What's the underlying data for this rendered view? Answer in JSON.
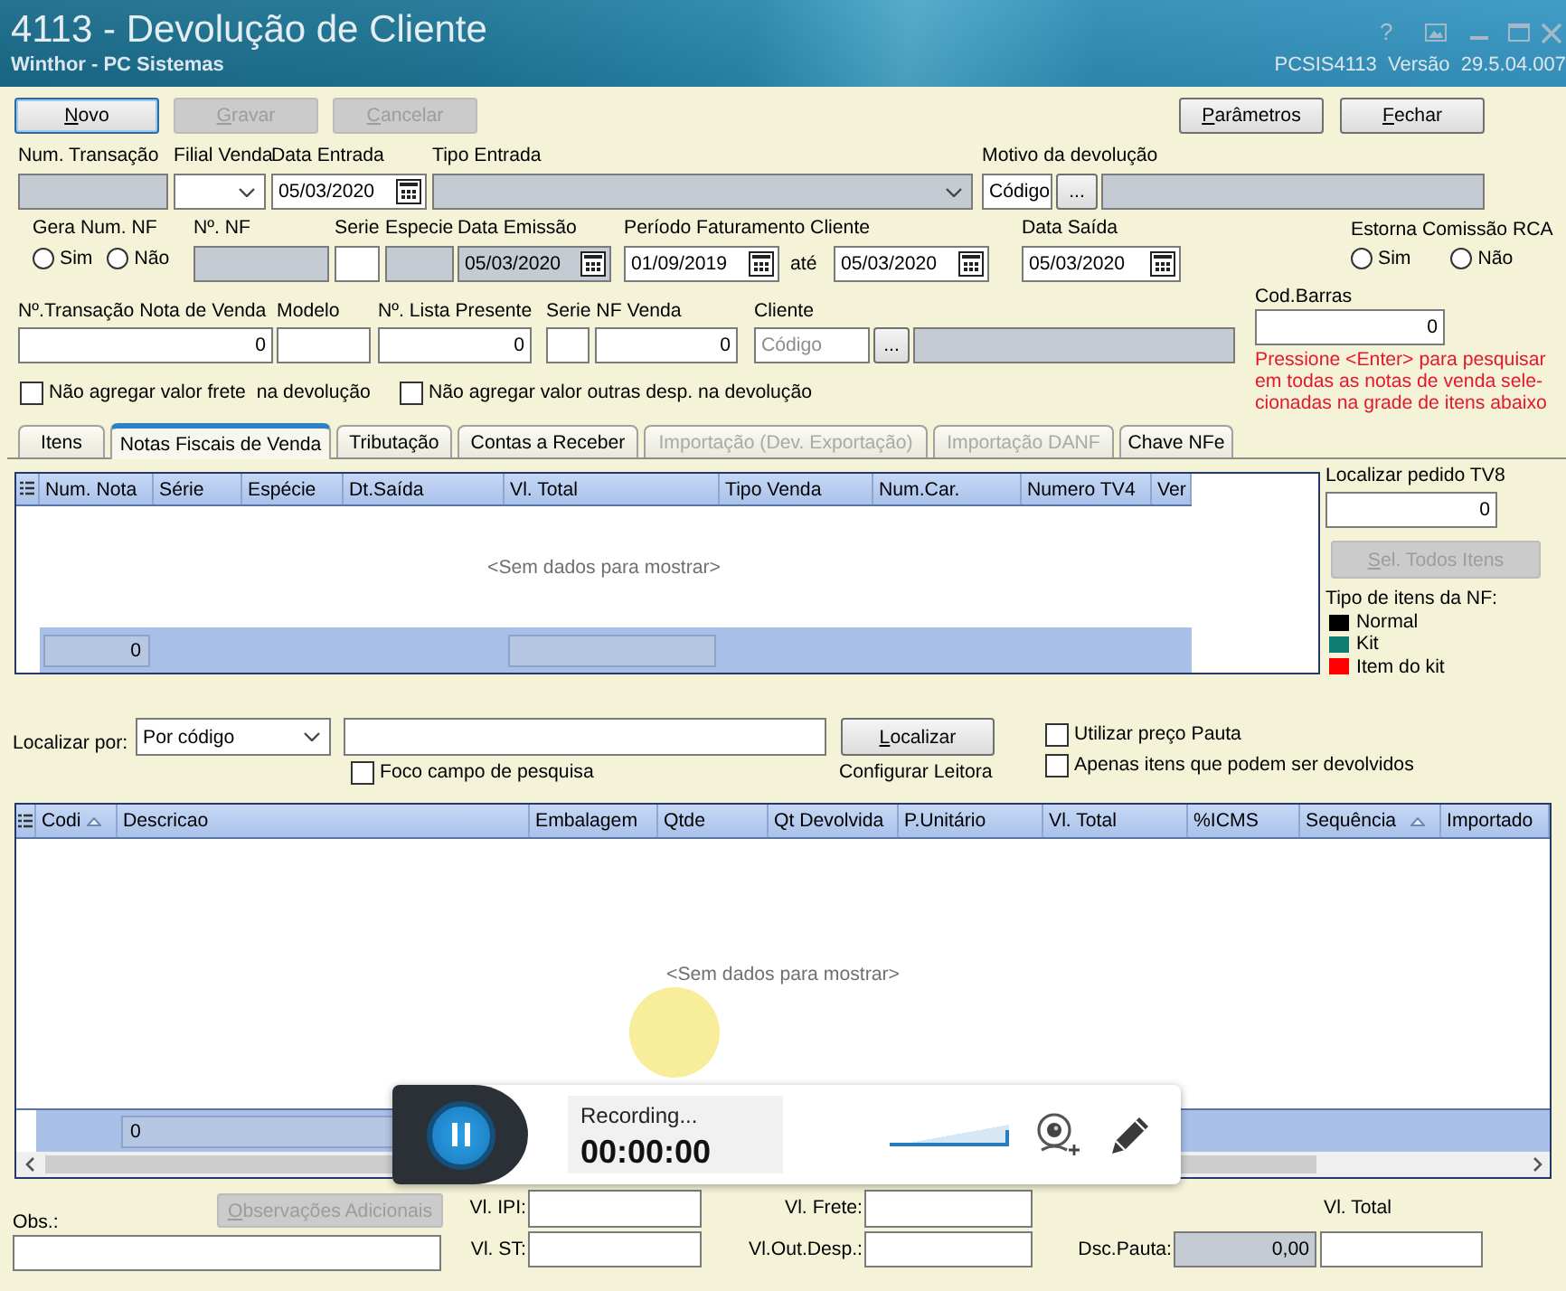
{
  "window": {
    "title": "4113 - Devolução de Cliente",
    "subtitle": "Winthor - PC Sistemas",
    "help": "?",
    "version": "PCSIS4113  Versão  29.5.04.007"
  },
  "toolbar": {
    "left": [
      {
        "label": "Novo",
        "disabled": false,
        "focused": true
      },
      {
        "label": "Gravar",
        "disabled": true,
        "focused": false
      },
      {
        "label": "Cancelar",
        "disabled": true,
        "focused": false
      }
    ],
    "right": [
      {
        "label": "Parâmetros",
        "disabled": false,
        "focused": false
      },
      {
        "label": "Fechar",
        "disabled": false,
        "focused": false
      }
    ]
  },
  "row_1": [
    {
      "kind": "text",
      "label": "Num. Transação",
      "readonly": true
    },
    {
      "kind": "combo",
      "label": "Filial Venda",
      "readonly": false
    },
    {
      "kind": "date",
      "label": "Data Entrada",
      "value": "05/03/2020",
      "readonly": false
    },
    {
      "kind": "combo",
      "label": "Tipo Entrada",
      "readonly": true
    },
    {
      "kind": "lookup",
      "label": "Motivo da devolução",
      "value": "Código",
      "button": "...",
      "readonly": true
    }
  ],
  "gera_num_nf": {
    "label": "Gera Num. NF",
    "options": [
      {
        "label": "Sim",
        "selected": false
      },
      {
        "label": "Não",
        "selected": false
      }
    ]
  },
  "row_2": [
    {
      "kind": "text",
      "label": "Nº. NF",
      "readonly": true
    },
    {
      "kind": "text",
      "label": "Serie",
      "readonly": false
    },
    {
      "kind": "text",
      "label": "Especie",
      "readonly": true
    },
    {
      "kind": "date",
      "label": "Data Emissão",
      "value": "05/03/2020",
      "readonly": true
    },
    {
      "kind": "range",
      "label": "Período Faturamento Cliente",
      "value": "01/09/2019",
      "separator": "até",
      "value_to": "05/03/2020",
      "readonly": false
    },
    {
      "kind": "date",
      "label": "Data Saída",
      "value": "05/03/2020",
      "readonly": false
    }
  ],
  "estorna_comissao_rca": {
    "label": "Estorna Comissão RCA",
    "options": [
      {
        "label": "Sim",
        "selected": false
      },
      {
        "label": "Não",
        "selected": false
      }
    ]
  },
  "row_3": [
    {
      "kind": "number",
      "label": "Nº.Transação Nota de Venda",
      "value": "0",
      "readonly": false
    },
    {
      "kind": "text",
      "label": "Modelo",
      "readonly": false
    },
    {
      "kind": "number",
      "label": "Nº. Lista Presente",
      "value": "0",
      "readonly": false
    },
    {
      "kind": "text",
      "label": "Serie NF Venda",
      "readonly": false
    },
    {
      "kind": "number",
      "value": "0",
      "readonly": false
    },
    {
      "kind": "lookup",
      "label": "Cliente",
      "placeholder": "Código",
      "button": "...",
      "readonly": true
    }
  ],
  "cod_barras": {
    "label": "Cod.Barras",
    "value": "0",
    "hint_lines": [
      "Pressione <Enter> para pesquisar",
      "em todas as notas de venda sele-",
      "cionadas na grade de itens abaixo"
    ]
  },
  "checkboxes": [
    {
      "label": "Não agregar valor frete  na devolução",
      "checked": false
    },
    {
      "label": "Não agregar valor outras desp. na devolução",
      "checked": false
    }
  ],
  "tabs": [
    {
      "label": "Itens",
      "selected": false,
      "disabled": false
    },
    {
      "label": "Notas Fiscais de Venda",
      "selected": true,
      "disabled": false
    },
    {
      "label": "Tributação",
      "selected": false,
      "disabled": false
    },
    {
      "label": "Contas a Receber",
      "selected": false,
      "disabled": false
    },
    {
      "label": "Importação (Dev. Exportação)",
      "selected": false,
      "disabled": true
    },
    {
      "label": "Importação DANF",
      "selected": false,
      "disabled": true
    },
    {
      "label": "Chave NFe",
      "selected": false,
      "disabled": false
    }
  ],
  "notas_grid": {
    "columns": [
      {
        "label": "Num. Nota"
      },
      {
        "label": "Série"
      },
      {
        "label": "Espécie"
      },
      {
        "label": "Dt.Saída"
      },
      {
        "label": "Vl. Total"
      },
      {
        "label": "Tipo Venda"
      },
      {
        "label": "Num.Car."
      },
      {
        "label": "Numero TV4"
      },
      {
        "label": "Ver"
      }
    ],
    "empty_text": "<Sem dados para mostrar>",
    "footer": [
      {
        "kind": "cell",
        "value": "0"
      },
      {
        "kind": "none"
      },
      {
        "kind": "none"
      },
      {
        "kind": "none"
      },
      {
        "kind": "cell"
      }
    ]
  },
  "pedido_tv8": {
    "label": "Localizar pedido TV8",
    "value": "0",
    "button": {
      "label": "Sel. Todos Itens",
      "disabled": true
    }
  },
  "legend": {
    "title": "Tipo de itens da NF:",
    "items": [
      {
        "label": "Normal",
        "color": "#000000"
      },
      {
        "label": "Kit",
        "color": "#0e7e72"
      },
      {
        "label": "Item do kit",
        "color": "#ff0000"
      }
    ]
  },
  "search": {
    "label": "Localizar por:",
    "mode": "Por código",
    "button": {
      "label": "Localizar",
      "disabled": false
    },
    "focus_option": {
      "label": "Foco campo de pesquisa",
      "checked": false
    },
    "reader": "Configurar Leitora",
    "options": [
      {
        "label": "Utilizar preço Pauta",
        "checked": false
      },
      {
        "label": "Apenas itens que podem ser devolvidos",
        "checked": false
      }
    ]
  },
  "itens_grid": {
    "columns": [
      {
        "label": "Codi",
        "sorted": true
      },
      {
        "label": "Descricao",
        "sorted": false
      },
      {
        "label": "Embalagem",
        "sorted": false
      },
      {
        "label": "Qtde",
        "sorted": false
      },
      {
        "label": "Qt Devolvida",
        "sorted": false
      },
      {
        "label": "P.Unitário",
        "sorted": false
      },
      {
        "label": "Vl. Total",
        "sorted": false
      },
      {
        "label": "%ICMS",
        "sorted": false
      },
      {
        "label": "Sequência",
        "sorted": true
      },
      {
        "label": "Importado",
        "sorted": false
      }
    ],
    "empty_text": "<Sem dados para mostrar>",
    "footer": [
      {
        "kind": "none"
      },
      {
        "kind": "cell",
        "value": "0"
      }
    ]
  },
  "recording": {
    "status": "Recording...",
    "time": "00:00:00",
    "volume": {
      "level": 1
    }
  },
  "observacoes": {
    "label": "Obs.:",
    "button": {
      "label": "Observações Adicionais",
      "disabled": true
    }
  },
  "totals": [
    {
      "label": "Vl. IPI:",
      "readonly": false
    },
    {
      "label": "Vl. Frete:",
      "readonly": false
    },
    {
      "label": "Vl. Total",
      "readonly": false
    },
    {
      "label": "Vl. ST:",
      "readonly": false
    },
    {
      "label": "Vl.Out.Desp.:",
      "readonly": false
    },
    {
      "label": "Dsc.Pauta:",
      "value": "0,00",
      "readonly": true
    }
  ]
}
